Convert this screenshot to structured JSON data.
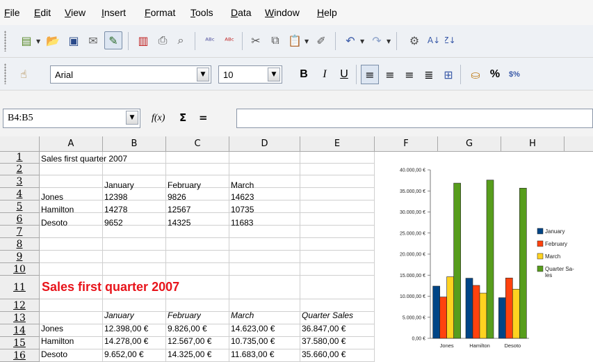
{
  "menu": [
    "File",
    "Edit",
    "View",
    "Insert",
    "Format",
    "Tools",
    "Data",
    "Window",
    "Help"
  ],
  "toolbar_icons": [
    "new-document-icon",
    "open-folder-icon",
    "save-icon",
    "email-icon",
    "edit-mode-icon",
    "export-pdf-icon",
    "print-icon",
    "page-preview-icon",
    "spellcheck-icon",
    "autospellcheck-icon",
    "cut-icon",
    "copy-icon",
    "paste-icon",
    "clone-formatting-icon",
    "undo-icon",
    "redo-icon",
    "navigator-icon",
    "sort-ascending-icon"
  ],
  "format_bar": {
    "font_name": "Arial",
    "font_size": "10",
    "bold": "B",
    "italic": "I",
    "underline": "U",
    "percent": "%",
    "currency": "$%"
  },
  "formula_bar": {
    "name_box": "B4:B5",
    "function_wizard": "f(x)",
    "sum": "Σ",
    "equals": "=",
    "input": ""
  },
  "columns": [
    "A",
    "B",
    "C",
    "D",
    "E",
    "F",
    "G",
    "H"
  ],
  "rows": [
    "1",
    "2",
    "3",
    "4",
    "5",
    "6",
    "7",
    "8",
    "9",
    "10",
    "11",
    "12",
    "13",
    "14",
    "15",
    "16"
  ],
  "sheet": {
    "a1": "Sales first quarter 2007",
    "head1": [
      "January",
      "February",
      "March"
    ],
    "table1": [
      [
        "Jones",
        "12398",
        "9826",
        "14623"
      ],
      [
        "Hamilton",
        "14278",
        "12567",
        "10735"
      ],
      [
        "Desoto",
        "9652",
        "14325",
        "11683"
      ]
    ],
    "a11": "Sales first quarter 2007",
    "head2": [
      "January",
      "February",
      "March",
      "Quarter Sales"
    ],
    "table2": [
      [
        "Jones",
        "12.398,00 €",
        "9.826,00 €",
        "14.623,00 €",
        "36.847,00 €"
      ],
      [
        "Hamilton",
        "14.278,00 €",
        "12.567,00 €",
        "10.735,00 €",
        "37.580,00 €"
      ],
      [
        "Desoto",
        "9.652,00 €",
        "14.325,00 €",
        "11.683,00 €",
        "35.660,00 €"
      ]
    ]
  },
  "chart_data": {
    "type": "bar",
    "categories": [
      "Jones",
      "Hamilton",
      "Desoto"
    ],
    "series": [
      {
        "name": "January",
        "values": [
          12398,
          14278,
          9652
        ],
        "color": "#004586"
      },
      {
        "name": "February",
        "values": [
          9826,
          12567,
          14325
        ],
        "color": "#ff420e"
      },
      {
        "name": "March",
        "values": [
          14623,
          10735,
          11683
        ],
        "color": "#ffd320"
      },
      {
        "name": "Quarter Sa-\nles",
        "values": [
          36847,
          37580,
          35660
        ],
        "color": "#579d1c"
      }
    ],
    "yticks": [
      "0,00 €",
      "5.000,00 €",
      "10.000,00 €",
      "15.000,00 €",
      "20.000,00 €",
      "25.000,00 €",
      "30.000,00 €",
      "35.000,00 €",
      "40.000,00 €"
    ],
    "ylim": [
      0,
      40000
    ],
    "legend": "right",
    "grid": false
  }
}
